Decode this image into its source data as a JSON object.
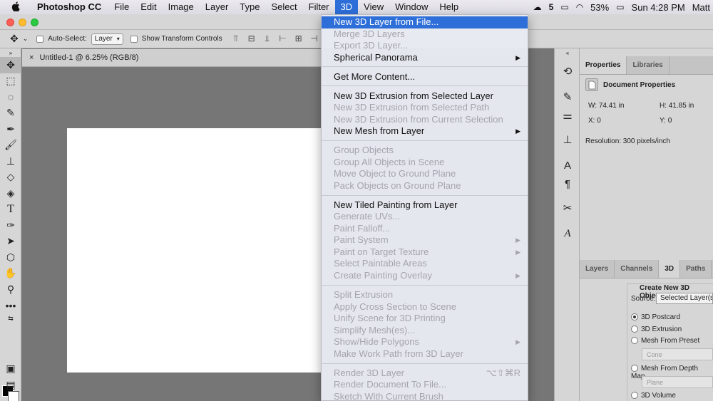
{
  "menubar": {
    "app_name": "Photoshop CC",
    "items": [
      "File",
      "Edit",
      "Image",
      "Layer",
      "Type",
      "Select",
      "Filter",
      "3D",
      "View",
      "Window",
      "Help"
    ],
    "status": {
      "battery": "53%",
      "clock": "Sun 4:28 PM",
      "user": "Matt"
    }
  },
  "options_bar": {
    "auto_select_label": "Auto-Select:",
    "auto_select_value": "Layer",
    "show_transform_label": "Show Transform Controls"
  },
  "document": {
    "tab_title": "Untitled-1 @ 6.25% (RGB/8)",
    "close_glyph": "×"
  },
  "menu_3d": {
    "items": [
      {
        "label": "New 3D Layer from File...",
        "enabled": true,
        "highlighted": true
      },
      {
        "label": "Merge 3D Layers",
        "enabled": false
      },
      {
        "label": "Export 3D Layer...",
        "enabled": false
      },
      {
        "label": "Spherical Panorama",
        "enabled": true,
        "submenu": true
      },
      {
        "label": "Get More Content...",
        "enabled": true
      },
      {
        "label": "New 3D Extrusion from Selected Layer",
        "enabled": true
      },
      {
        "label": "New 3D Extrusion from Selected Path",
        "enabled": false
      },
      {
        "label": "New 3D Extrusion from Current Selection",
        "enabled": false
      },
      {
        "label": "New Mesh from Layer",
        "enabled": true,
        "submenu": true
      },
      {
        "label": "Group Objects",
        "enabled": false
      },
      {
        "label": "Group All Objects in Scene",
        "enabled": false
      },
      {
        "label": "Move Object to Ground Plane",
        "enabled": false
      },
      {
        "label": "Pack Objects on Ground Plane",
        "enabled": false
      },
      {
        "label": "New Tiled Painting from Layer",
        "enabled": true
      },
      {
        "label": "Generate UVs...",
        "enabled": false
      },
      {
        "label": "Paint Falloff...",
        "enabled": false
      },
      {
        "label": "Paint System",
        "enabled": false,
        "submenu": true
      },
      {
        "label": "Paint on Target Texture",
        "enabled": false,
        "submenu": true
      },
      {
        "label": "Select Paintable Areas",
        "enabled": false
      },
      {
        "label": "Create Painting Overlay",
        "enabled": false,
        "submenu": true
      },
      {
        "label": "Split Extrusion",
        "enabled": false
      },
      {
        "label": "Apply Cross Section to Scene",
        "enabled": false
      },
      {
        "label": "Unify Scene for 3D Printing",
        "enabled": false
      },
      {
        "label": "Simplify Mesh(es)...",
        "enabled": false
      },
      {
        "label": "Show/Hide Polygons",
        "enabled": false,
        "submenu": true
      },
      {
        "label": "Make Work Path from 3D Layer",
        "enabled": false
      },
      {
        "label": "Render 3D Layer",
        "enabled": false,
        "shortcut": "⌥⇧⌘R"
      },
      {
        "label": "Render Document To File...",
        "enabled": false
      },
      {
        "label": "Sketch With Current Brush",
        "enabled": false
      }
    ]
  },
  "properties_panel": {
    "tabs": [
      "Properties",
      "Libraries"
    ],
    "header": "Document Properties",
    "w_label": "W:",
    "w_value": "74.41 in",
    "h_label": "H:",
    "h_value": "41.85 in",
    "x_label": "X:",
    "x_value": "0",
    "y_label": "Y:",
    "y_value": "0",
    "resolution": "Resolution: 300 pixels/inch"
  },
  "layers_panel": {
    "tabs": [
      "Layers",
      "Channels",
      "3D",
      "Paths"
    ],
    "section_title": "Create New 3D Object",
    "source_label": "Source:",
    "source_value": "Selected Layer(s)",
    "options": [
      {
        "label": "3D Postcard",
        "selected": true
      },
      {
        "label": "3D Extrusion",
        "selected": false
      },
      {
        "label": "Mesh From Preset",
        "selected": false
      },
      {
        "label": "Mesh From Depth Map",
        "selected": false
      },
      {
        "label": "3D Volume",
        "selected": false
      }
    ],
    "preset_value": "Cone",
    "depth_map_value": "Plane"
  },
  "colors": {
    "accent": "#2d6ed8",
    "foreground_swatch": "#000000",
    "background_swatch": "#ffffff"
  }
}
